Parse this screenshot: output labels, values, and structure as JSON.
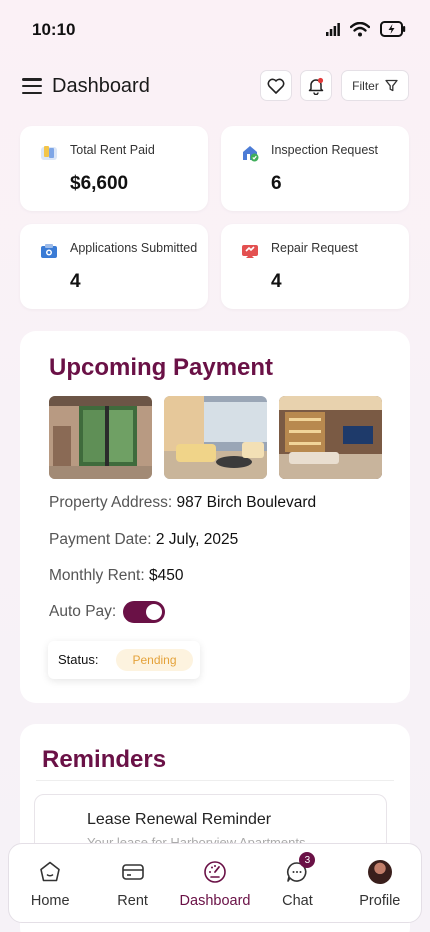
{
  "status_bar": {
    "time": "10:10"
  },
  "header": {
    "title": "Dashboard",
    "filter_label": "Filter"
  },
  "stats": [
    {
      "label": "Total Rent Paid",
      "value": "$6,600",
      "icon": "rent-paid-icon"
    },
    {
      "label": "Inspection Request",
      "value": "6",
      "icon": "inspection-icon"
    },
    {
      "label": "Applications Submitted",
      "value": "4",
      "icon": "applications-icon"
    },
    {
      "label": "Repair Request",
      "value": "4",
      "icon": "repair-icon"
    }
  ],
  "payment": {
    "title": "Upcoming Payment",
    "address_label": "Property Address:",
    "address_value": "987 Birch Boulevard",
    "date_label": "Payment Date:",
    "date_value": "2 July, 2025",
    "rent_label": "Monthly Rent:",
    "rent_value": "$450",
    "autopay_label": "Auto Pay:",
    "autopay_on": true,
    "status_label": "Status:",
    "status_value": "Pending"
  },
  "reminders": {
    "title": "Reminders",
    "items": [
      {
        "title": "Lease Renewal Reminder",
        "subtitle": "Your lease for Harborview Apartments"
      }
    ]
  },
  "nav": {
    "items": [
      {
        "label": "Home",
        "icon": "home-icon"
      },
      {
        "label": "Rent",
        "icon": "rent-icon"
      },
      {
        "label": "Dashboard",
        "icon": "dashboard-icon",
        "active": true
      },
      {
        "label": "Chat",
        "icon": "chat-icon",
        "badge": "3"
      },
      {
        "label": "Profile",
        "icon": "avatar"
      }
    ]
  },
  "colors": {
    "accent": "#6a1146",
    "pending_text": "#e4a23a",
    "pending_bg": "#fdf3df"
  }
}
